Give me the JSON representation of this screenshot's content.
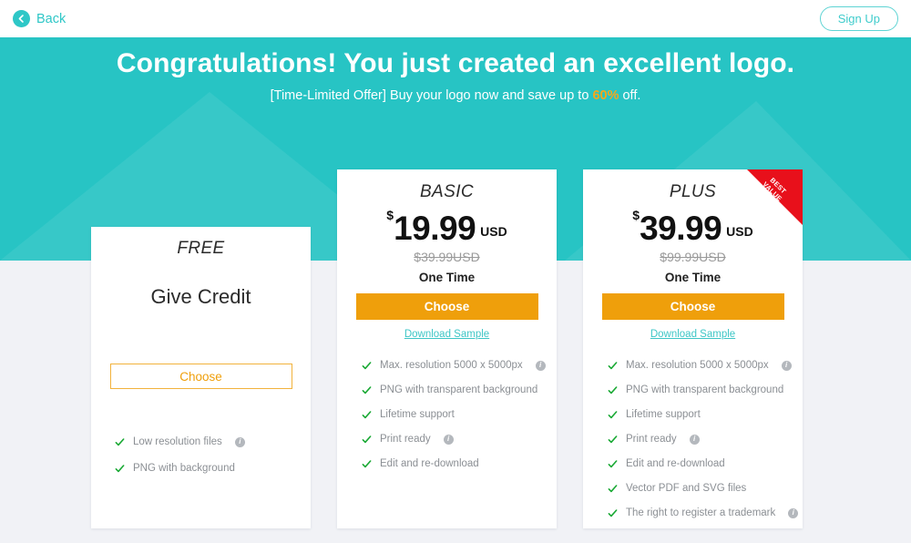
{
  "header": {
    "back_label": "Back",
    "back_icon": "arrow-left-circle-icon",
    "signup_label": "Sign Up"
  },
  "hero": {
    "title": "Congratulations! You just created an excellent logo.",
    "subtitle_before": "[Time-Limited Offer] Buy your logo now and save up to ",
    "subtitle_highlight": "60%",
    "subtitle_after": " off.",
    "background_color": "#27c4c4",
    "highlight_color": "#f7a81b"
  },
  "plans": {
    "free": {
      "name": "FREE",
      "headline": "Give Credit",
      "choose_label": "Choose",
      "features": [
        {
          "label": "Low resolution files",
          "info": true
        },
        {
          "label": "PNG with background",
          "info": false
        }
      ]
    },
    "basic": {
      "name": "BASIC",
      "currency_symbol": "$",
      "price": "19.99",
      "currency_code": "USD",
      "old_price": "$39.99USD",
      "term": "One Time",
      "choose_label": "Choose",
      "download_sample_label": "Download Sample",
      "features": [
        {
          "label": "Max. resolution 5000 x 5000px",
          "info": true
        },
        {
          "label": "PNG with transparent background",
          "info": false
        },
        {
          "label": "Lifetime support",
          "info": false
        },
        {
          "label": "Print ready",
          "info": true
        },
        {
          "label": "Edit and re-download",
          "info": false
        }
      ]
    },
    "plus": {
      "name": "PLUS",
      "currency_symbol": "$",
      "price": "39.99",
      "currency_code": "USD",
      "old_price": "$99.99USD",
      "term": "One Time",
      "choose_label": "Choose",
      "download_sample_label": "Download Sample",
      "ribbon_line1": "BEST",
      "ribbon_line2": "VALUE",
      "ribbon_color": "#e8101b",
      "features": [
        {
          "label": "Max. resolution 5000 x 5000px",
          "info": true
        },
        {
          "label": "PNG with transparent background",
          "info": false
        },
        {
          "label": "Lifetime support",
          "info": false
        },
        {
          "label": "Print ready",
          "info": true
        },
        {
          "label": "Edit and re-download",
          "info": false
        },
        {
          "label": "Vector PDF and SVG files",
          "info": false
        },
        {
          "label": "The right to register a trademark",
          "info": true
        }
      ]
    }
  },
  "colors": {
    "teal": "#27c4c4",
    "orange": "#ef9f0b",
    "check_green": "#17a832",
    "page_bg": "#f1f2f6"
  }
}
